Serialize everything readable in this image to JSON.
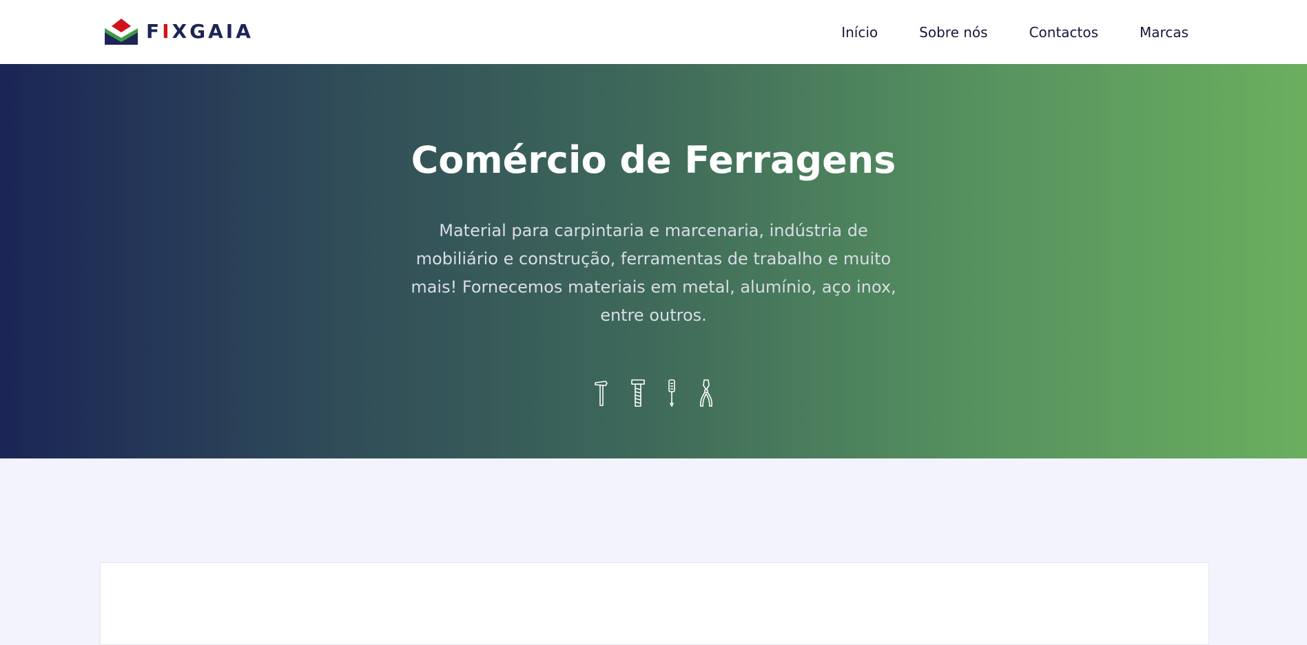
{
  "header": {
    "logo": {
      "text_prefix": "F",
      "text_accent": "I",
      "text_suffix": "XGAIA",
      "icon": "house-roof-logo-icon"
    },
    "nav": [
      {
        "label": "Início"
      },
      {
        "label": "Sobre nós"
      },
      {
        "label": "Contactos"
      },
      {
        "label": "Marcas"
      }
    ]
  },
  "hero": {
    "title": "Comércio de Ferragens",
    "description": "Material para carpintaria e marcenaria, indústria de mobiliário e construção, ferramentas de trabalho e muito mais! Fornecemos materiais em metal, alumínio, aço inox, entre outros.",
    "icons": [
      "hammer-icon",
      "bolt-icon",
      "screwdriver-icon",
      "pliers-icon"
    ],
    "gradient": [
      "#1b2556",
      "#6aaf5e"
    ]
  },
  "colors": {
    "brand_navy": "#1b2556",
    "brand_red": "#d0121a",
    "brand_green": "#6aaf5e",
    "page_background": "#f2f3fc"
  }
}
